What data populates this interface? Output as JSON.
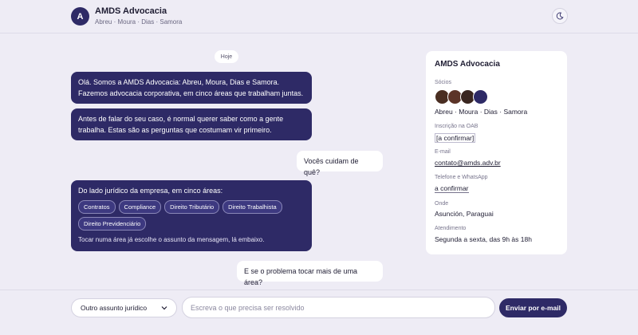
{
  "header": {
    "logo_letter": "A",
    "title": "AMDS Advocacia",
    "subtitle": "Abreu · Moura · Dias · Samora",
    "theme_icon": "moon-icon"
  },
  "chat": {
    "date_chip": "Hoje",
    "messages": [
      {
        "from": "bot",
        "lines": [
          "Olá. Somos a AMDS Advocacia: Abreu, Moura, Dias e Samora.",
          "Fazemos advocacia corporativa, em cinco áreas que trabalham juntas."
        ]
      },
      {
        "from": "bot",
        "lines": [
          "Antes de falar do seu caso, é normal querer saber como a gente",
          "trabalha. Estas são as perguntas que costumam vir primeiro."
        ]
      },
      {
        "from": "user",
        "text": "Vocês cuidam de quê?"
      },
      {
        "from": "bot",
        "text": "Do lado jurídico da empresa, em cinco áreas:",
        "chips": [
          "Contratos",
          "Compliance",
          "Direito Tributário",
          "Direito Trabalhista",
          "Direito Previdenciário"
        ],
        "hint": "Tocar numa área já escolhe o assunto da mensagem, lá embaixo."
      },
      {
        "from": "user",
        "text": "E se o problema tocar mais de uma área?"
      }
    ]
  },
  "card": {
    "title": "AMDS Advocacia",
    "partners_label": "Sócios",
    "partners_value": "Abreu · Moura · Dias · Samora",
    "oab_label": "Inscrição na OAB",
    "oab_value": "[a confirmar]",
    "email_label": "E-mail",
    "email_value": "contato@amds.adv.br",
    "phone_label": "Telefone e WhatsApp",
    "phone_value": "a confirmar",
    "where_label": "Onde",
    "where_value": "Asunción, Paraguai",
    "hours_label": "Atendimento",
    "hours_value": "Segunda a sexta, das 9h às 18h"
  },
  "footer": {
    "topic_selected": "Outro assunto jurídico",
    "message_placeholder": "Escreva o que precisa ser resolvido",
    "send_label": "Enviar por e-mail"
  },
  "colors": {
    "accent": "#2e2a66",
    "background": "#eeecf5"
  }
}
